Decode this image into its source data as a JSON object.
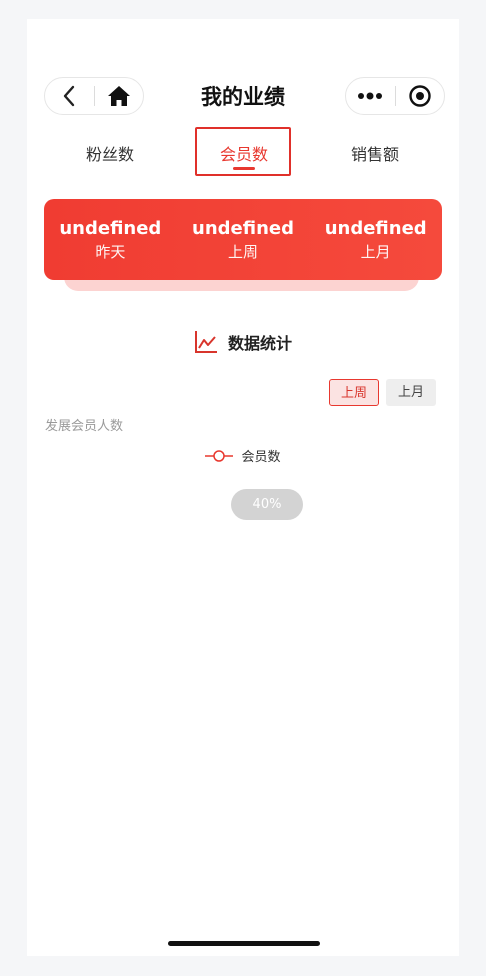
{
  "nav": {
    "title": "我的业绩",
    "back_icon": "chevron-left-icon",
    "home_icon": "home-icon",
    "more_icon": "more-dots-icon",
    "close_icon": "target-icon"
  },
  "tabs": [
    {
      "label": "粉丝数"
    },
    {
      "label": "会员数"
    },
    {
      "label": "销售额"
    }
  ],
  "active_tab_index": 1,
  "summary": {
    "items": [
      {
        "value": "undefined",
        "label": "昨天"
      },
      {
        "value": "undefined",
        "label": "上周"
      },
      {
        "value": "undefined",
        "label": "上月"
      }
    ]
  },
  "section": {
    "title": "数据统计",
    "icon": "line-chart-icon"
  },
  "period": {
    "week_label": "上周",
    "month_label": "上月",
    "selected": "上周"
  },
  "chart": {
    "ylabel": "发展会员人数",
    "legend": "会员数",
    "loading_text": "40%"
  },
  "colors": {
    "accent": "#e8382f",
    "card_gradient_start": "#f03c32",
    "card_gradient_end": "#f54a3c"
  }
}
